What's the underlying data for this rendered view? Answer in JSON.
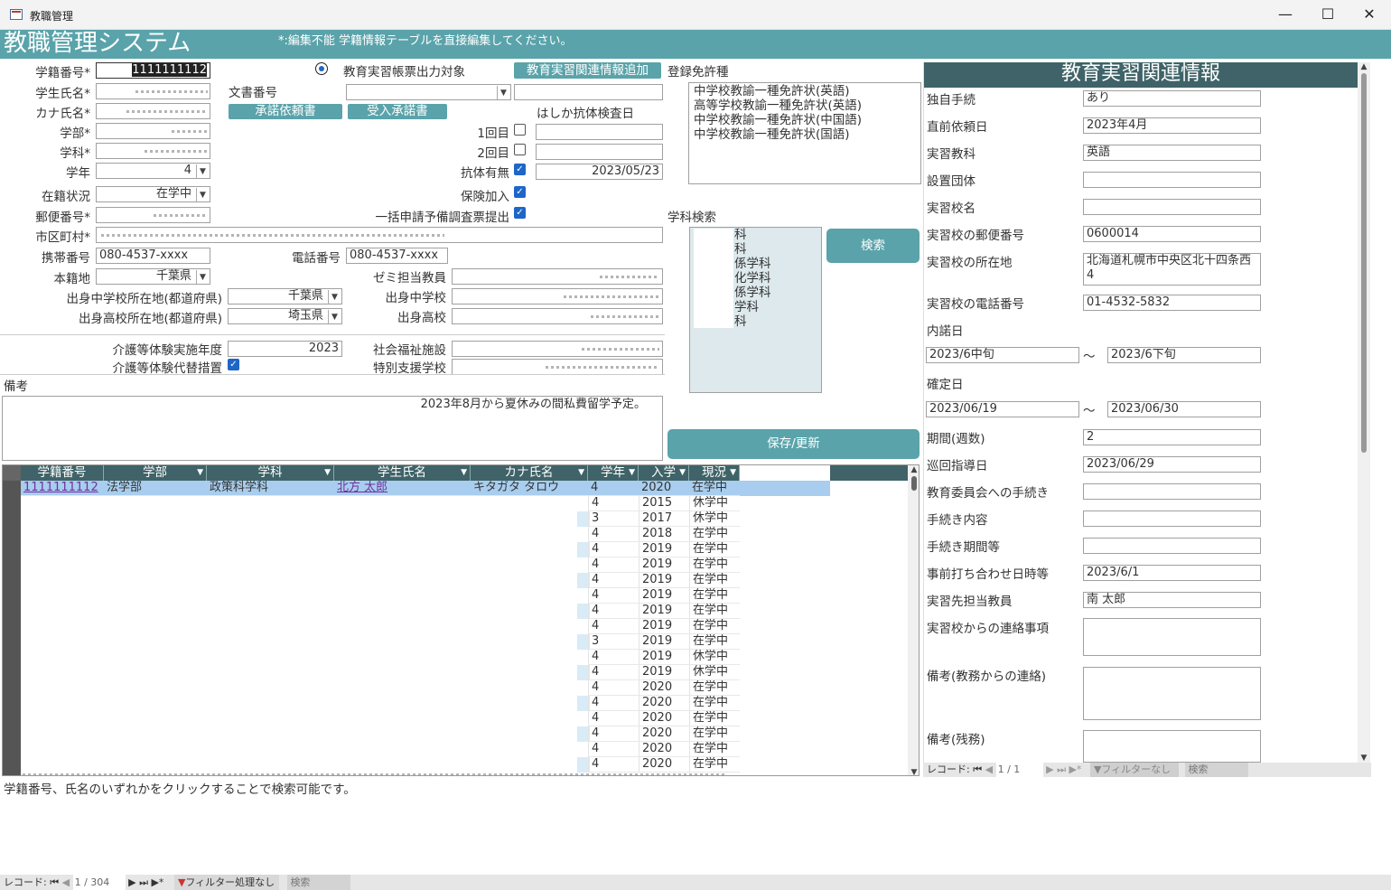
{
  "window": {
    "title": "教職管理"
  },
  "header": {
    "title": "教職管理システム",
    "note": "*:編集不能  学籍情報テーブルを直接編集してください。"
  },
  "form": {
    "student_no_label": "学籍番号*",
    "student_no": "1111111112",
    "name_label": "学生氏名*",
    "kana_label": "カナ氏名*",
    "faculty_label": "学部*",
    "dept_label": "学科*",
    "grade_label": "学年",
    "grade": "4",
    "status_label": "在籍状況",
    "status": "在学中",
    "zip_label": "郵便番号*",
    "city_label": "市区町村*",
    "mobile_label": "携帯番号",
    "mobile": "080-4537-xxxx",
    "phone_label": "電話番号",
    "phone": "080-4537-xxxx",
    "domicile_label": "本籍地",
    "domicile": "千葉県",
    "jhs_pref_label": "出身中学校所在地(都道府県)",
    "jhs_pref": "千葉県",
    "hs_pref_label": "出身高校所在地(都道府県)",
    "hs_pref": "埼玉県",
    "output_target_label": "教育実習帳票出力対象",
    "add_info_button": "教育実習関連情報追加",
    "doc_no_label": "文書番号",
    "request_button": "承諾依頼書",
    "accept_button": "受入承諾書",
    "measles_label": "はしか抗体検査日",
    "first_label": "1回目",
    "second_label": "2回目",
    "antibody_label": "抗体有無",
    "antibody_date": "2023/05/23",
    "insurance_label": "保険加入",
    "bulk_label": "一括申請予備調査票提出",
    "seminar_label": "ゼミ担当教員",
    "jhs_label": "出身中学校",
    "hs_label": "出身高校",
    "care_year_label": "介護等体験実施年度",
    "care_year": "2023",
    "care_alt_label": "介護等体験代替措置",
    "welfare_label": "社会福祉施設",
    "special_label": "特別支援学校",
    "remarks_label": "備考",
    "remarks": "2023年8月から夏休みの間私費留学予定。",
    "license_label": "登録免許種",
    "licenses": [
      "中学校教諭一種免許状(英語)",
      "高等学校教諭一種免許状(英語)",
      "中学校教諭一種免許状(中国語)",
      "中学校教諭一種免許状(国語)"
    ],
    "dept_search_label": "学科検索",
    "dept_list": [
      "科",
      "科",
      "係学科",
      "化学科",
      "係学科",
      "学科",
      "科"
    ],
    "search_button": "検索",
    "save_button": "保存/更新"
  },
  "practice": {
    "title": "教育実習関連情報",
    "fields": [
      {
        "label": "独自手続",
        "value": "あり"
      },
      {
        "label": "直前依頼日",
        "value": "2023年4月"
      },
      {
        "label": "実習教科",
        "value": "英語"
      },
      {
        "label": "設置団体",
        "value": ""
      },
      {
        "label": "実習校名",
        "value": ""
      },
      {
        "label": "実習校の郵便番号",
        "value": "0600014"
      },
      {
        "label": "実習校の所在地",
        "value": "北海道札幌市中央区北十四条西4"
      },
      {
        "label": "実習校の電話番号",
        "value": "01-4532-5832"
      }
    ],
    "naidaku_label": "内諾日",
    "naidaku_from": "2023/6中旬",
    "naidaku_to": "2023/6下旬",
    "kakutei_label": "確定日",
    "kakutei_from": "2023/06/19",
    "kakutei_to": "2023/06/30",
    "tilde": "～",
    "fields2": [
      {
        "label": "期間(週数)",
        "value": "2"
      },
      {
        "label": "巡回指導日",
        "value": "2023/06/29"
      },
      {
        "label": "教育委員会への手続き",
        "value": ""
      },
      {
        "label": "手続き内容",
        "value": ""
      },
      {
        "label": "手続き期間等",
        "value": ""
      },
      {
        "label": "事前打ち合わせ日時等",
        "value": "2023/6/1"
      },
      {
        "label": "実習先担当教員",
        "value": "南  太郎"
      }
    ],
    "contact_label": "実習校からの連絡事項",
    "remark_office_label": "備考(教務からの連絡)",
    "remark_rest_label": "備考(残務)",
    "nav": {
      "record_label": "レコード:",
      "position": "1 / 1",
      "filter": "フィルターなし",
      "search": "検索"
    }
  },
  "grid": {
    "columns": [
      "学籍番号",
      "学部",
      "学科",
      "学生氏名",
      "カナ氏名",
      "学年",
      "入学",
      "現況"
    ],
    "first_row": {
      "no": "1111111112",
      "faculty": "法学部",
      "dept": "政策科学科",
      "name": "北方  太郎",
      "kana": "キタガタ  タロウ",
      "grade": "4",
      "year": "2020",
      "status": "在学中"
    },
    "rows": [
      [
        "4",
        "2015",
        "休学中"
      ],
      [
        "3",
        "2017",
        "休学中"
      ],
      [
        "4",
        "2018",
        "在学中"
      ],
      [
        "4",
        "2019",
        "在学中"
      ],
      [
        "4",
        "2019",
        "在学中"
      ],
      [
        "4",
        "2019",
        "在学中"
      ],
      [
        "4",
        "2019",
        "在学中"
      ],
      [
        "4",
        "2019",
        "在学中"
      ],
      [
        "4",
        "2019",
        "在学中"
      ],
      [
        "3",
        "2019",
        "在学中"
      ],
      [
        "4",
        "2019",
        "休学中"
      ],
      [
        "4",
        "2019",
        "休学中"
      ],
      [
        "4",
        "2020",
        "在学中"
      ],
      [
        "4",
        "2020",
        "在学中"
      ],
      [
        "4",
        "2020",
        "在学中"
      ],
      [
        "4",
        "2020",
        "在学中"
      ],
      [
        "4",
        "2020",
        "在学中"
      ],
      [
        "4",
        "2020",
        "在学中"
      ]
    ]
  },
  "help_text": "学籍番号、氏名のいずれかをクリックすることで検索可能です。",
  "status_bar": {
    "record_label": "レコード:",
    "position": "1 / 304",
    "filter": "フィルター処理なし",
    "search": "検索"
  },
  "colors": {
    "accent": "#5aa3aa",
    "dark": "#3f6368",
    "check": "#1e66c8"
  }
}
